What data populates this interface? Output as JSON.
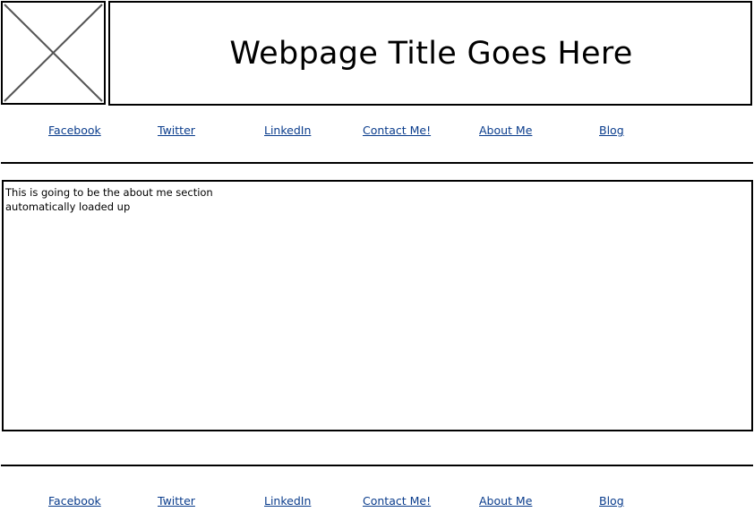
{
  "header": {
    "logo_icon": "image-placeholder-icon",
    "title": "Webpage Title Goes Here"
  },
  "nav_top": {
    "links": [
      "Facebook",
      "Twitter",
      "LinkedIn",
      "Contact Me!",
      "About Me",
      "Blog"
    ]
  },
  "content": {
    "text": "This is going to be the about me section\nautomatically loaded up"
  },
  "nav_bottom": {
    "links": [
      "Facebook",
      "Twitter",
      "LinkedIn",
      "Contact Me!",
      "About Me",
      "Blog"
    ]
  },
  "colors": {
    "link": "#0a3c8c",
    "border": "#000000",
    "background": "#ffffff"
  }
}
